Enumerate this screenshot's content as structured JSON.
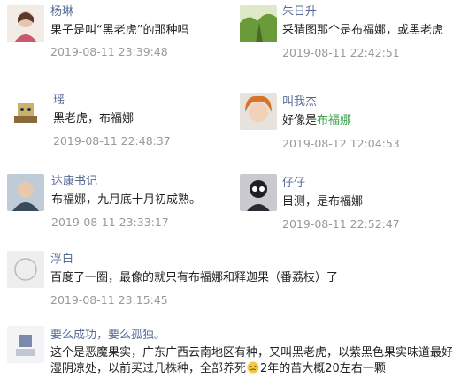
{
  "comments": [
    {
      "user": "杨琳",
      "text": "果子是叫“黑老虎”的那种吗",
      "time": "2019-08-11 23:39:48"
    },
    {
      "user": "朱日升",
      "text": "采猜图那个是布福娜，或黑老虎",
      "time": "2019-08-11 22:42:51"
    },
    {
      "user": "瑶",
      "text": "黑老虎，布福娜",
      "time": "2019-08-11 22:48:37"
    },
    {
      "user": "叫我杰",
      "text_prefix": "好像是",
      "text_link": "布福娜",
      "time": "2019-08-12 12:04:53"
    },
    {
      "user": "达康书记",
      "text": "布福娜，九月底十月初成熟。",
      "time": "2019-08-11 23:33:17"
    },
    {
      "user": "仔仔",
      "text": "目测，是布福娜",
      "time": "2019-08-11 22:52:47"
    },
    {
      "user": "浮白",
      "text": "百度了一圈，最像的就只有布福娜和释迦果（番荔枝）了",
      "time": "2019-08-11 23:15:45"
    },
    {
      "user": "要么成功，要么孤独。",
      "text_line1": "这个是恶魔果实，广东广西云南地区有种，又叫黑老虎，以紫黑色果实味道最好",
      "text_line2_a": "湿阴凉处，以前买过几株种，全部养死",
      "text_line2_b": "2年的苗大概20左右一颗"
    }
  ],
  "colors": {
    "name": "#576b95",
    "time": "#999999",
    "highlight": "#3ea24a"
  }
}
